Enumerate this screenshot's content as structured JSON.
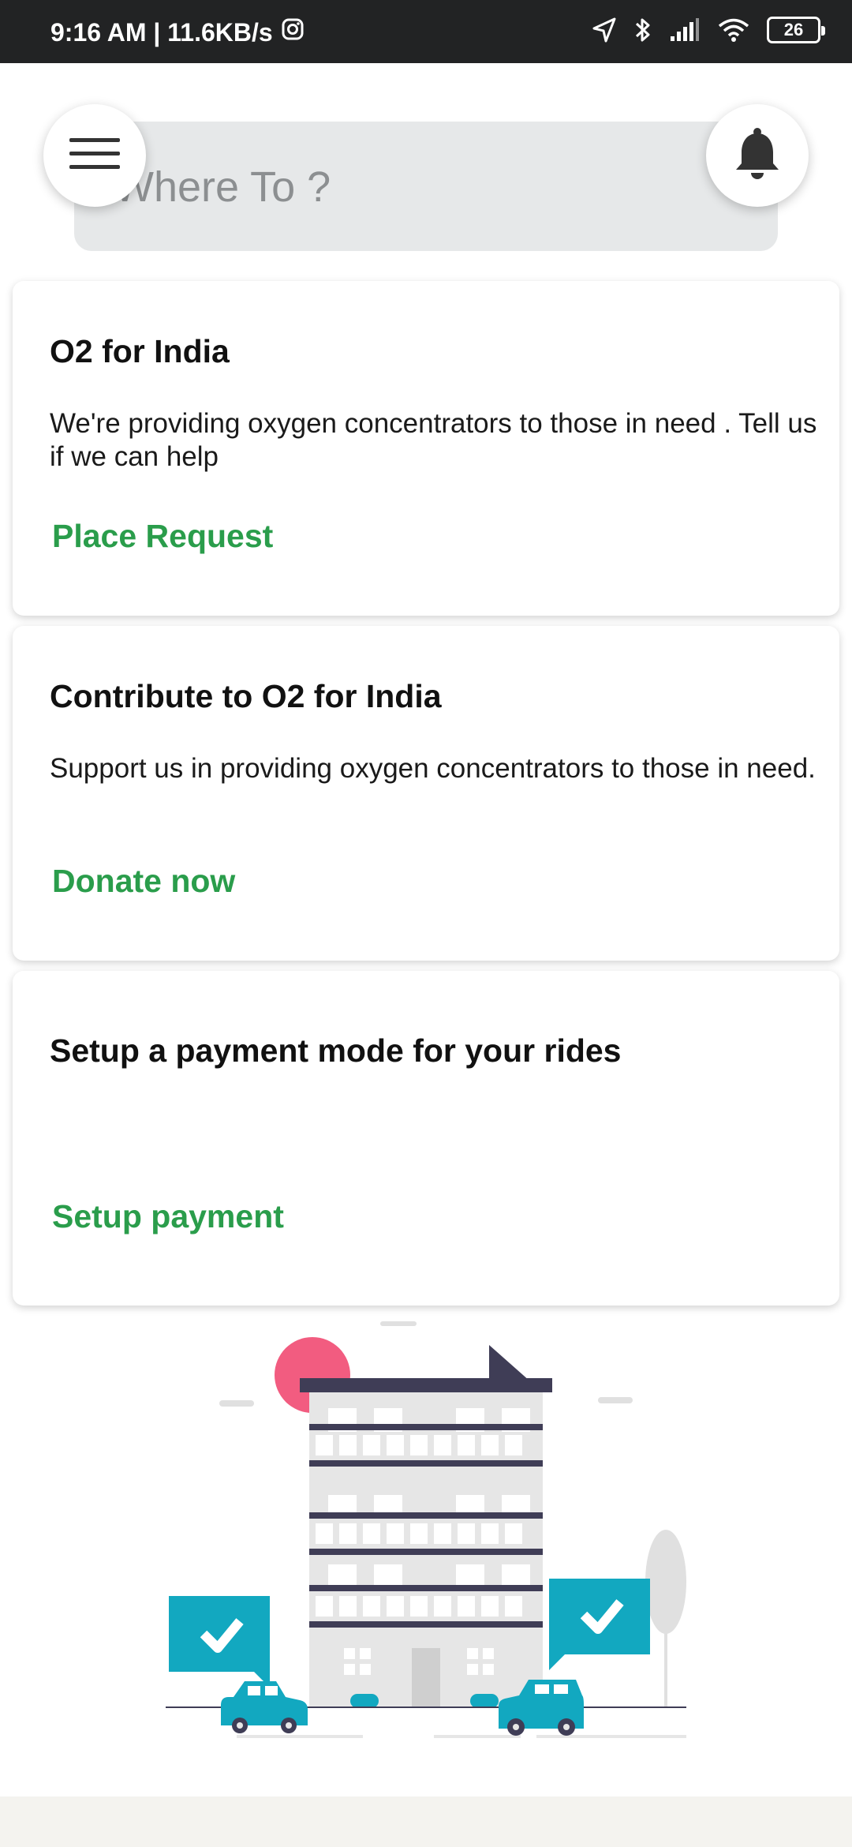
{
  "status_bar": {
    "time_speed": "9:16 AM | 11.6KB/s",
    "battery": "26"
  },
  "search": {
    "placeholder": "Where To ?"
  },
  "cards": [
    {
      "title": "O2 for India",
      "description": "We're providing oxygen concentrators to those in need . Tell us if we can help",
      "action": "Place Request"
    },
    {
      "title": "Contribute to O2 for India",
      "description": "Support us in providing oxygen  concentrators to those in need.",
      "action": "Donate now"
    },
    {
      "title": "Setup a payment mode for your rides",
      "description": "",
      "action": "Setup payment"
    }
  ],
  "colors": {
    "accent_green": "#2a9d4b",
    "status_bar": "#222324",
    "teal": "#12a8c0",
    "pink": "#f25c80",
    "building_dark": "#3f3d56"
  }
}
